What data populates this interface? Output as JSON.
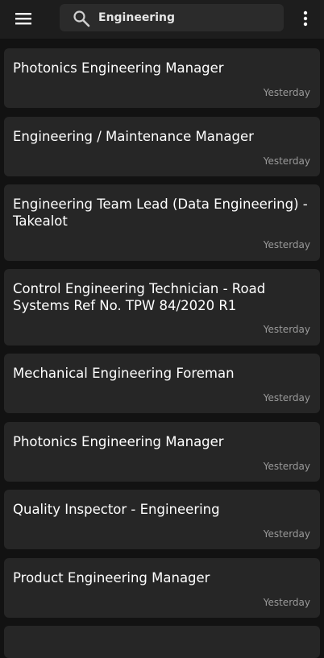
{
  "header": {
    "menu_icon": "hamburger-menu-icon",
    "search_icon": "search-icon",
    "search_value": "Engineering",
    "more_icon": "more-vertical-icon"
  },
  "jobs": [
    {
      "title": "Photonics Engineering Manager",
      "time": "Yesterday"
    },
    {
      "title": "Engineering / Maintenance Manager",
      "time": "Yesterday"
    },
    {
      "title": "Engineering Team Lead (Data Engineering) - Takealot",
      "time": "Yesterday"
    },
    {
      "title": "Control Engineering Technician - Road Systems Ref No. TPW 84/2020 R1",
      "time": "Yesterday"
    },
    {
      "title": "Mechanical Engineering Foreman",
      "time": "Yesterday"
    },
    {
      "title": "Photonics Engineering Manager",
      "time": "Yesterday"
    },
    {
      "title": "Quality Inspector - Engineering",
      "time": "Yesterday"
    },
    {
      "title": "Product Engineering Manager",
      "time": "Yesterday"
    }
  ],
  "colors": {
    "background": "#121212",
    "toolbar": "#1d1d1d",
    "card": "#262626",
    "secondary_text": "#9a9a9a"
  }
}
